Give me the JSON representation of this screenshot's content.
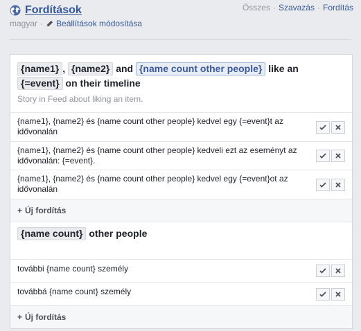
{
  "header": {
    "title": "Fordítások",
    "language": "magyar",
    "separator": "·",
    "settings_link": "Beállítások módosítása",
    "links": [
      {
        "label": "Összes",
        "active": false
      },
      {
        "label": "Szavazás",
        "active": true
      },
      {
        "label": "Fordítás",
        "active": true
      }
    ]
  },
  "block1": {
    "source": {
      "token_name1": "{name1}",
      "comma": ",",
      "token_name2": "{name2}",
      "and": "and",
      "token_count": "{name count other people}",
      "like_an": "like an",
      "token_event": "{=event}",
      "tail": "on their timeline"
    },
    "description": "Story in Feed about liking an item.",
    "translations": [
      "{name1}, {name2} és {name count other people} kedvel egy {=event}t az idővonalán",
      "{name1}, {name2} és {name count other people} kedveli ezt az eseményt az idővonalán: {=event}.",
      "{name1}, {name2} és {name count other people} kedvel egy {=event}ot az idővonalán"
    ],
    "add_label": "Új fordítás"
  },
  "block2": {
    "source": {
      "token": "{name count}",
      "tail": "other people"
    },
    "translations": [
      "további {name count} személy",
      "továbbá {name count} személy"
    ],
    "add_label": "Új fordítás"
  },
  "icons": {
    "globe": "globe-icon",
    "pencil": "pencil-icon",
    "accept": "check-icon",
    "reject": "close-icon",
    "add": "plus-icon"
  },
  "colors": {
    "link": "#365899",
    "muted": "#90949c",
    "page_bg": "#e9ebee",
    "token_highlight": "#3b5998"
  }
}
